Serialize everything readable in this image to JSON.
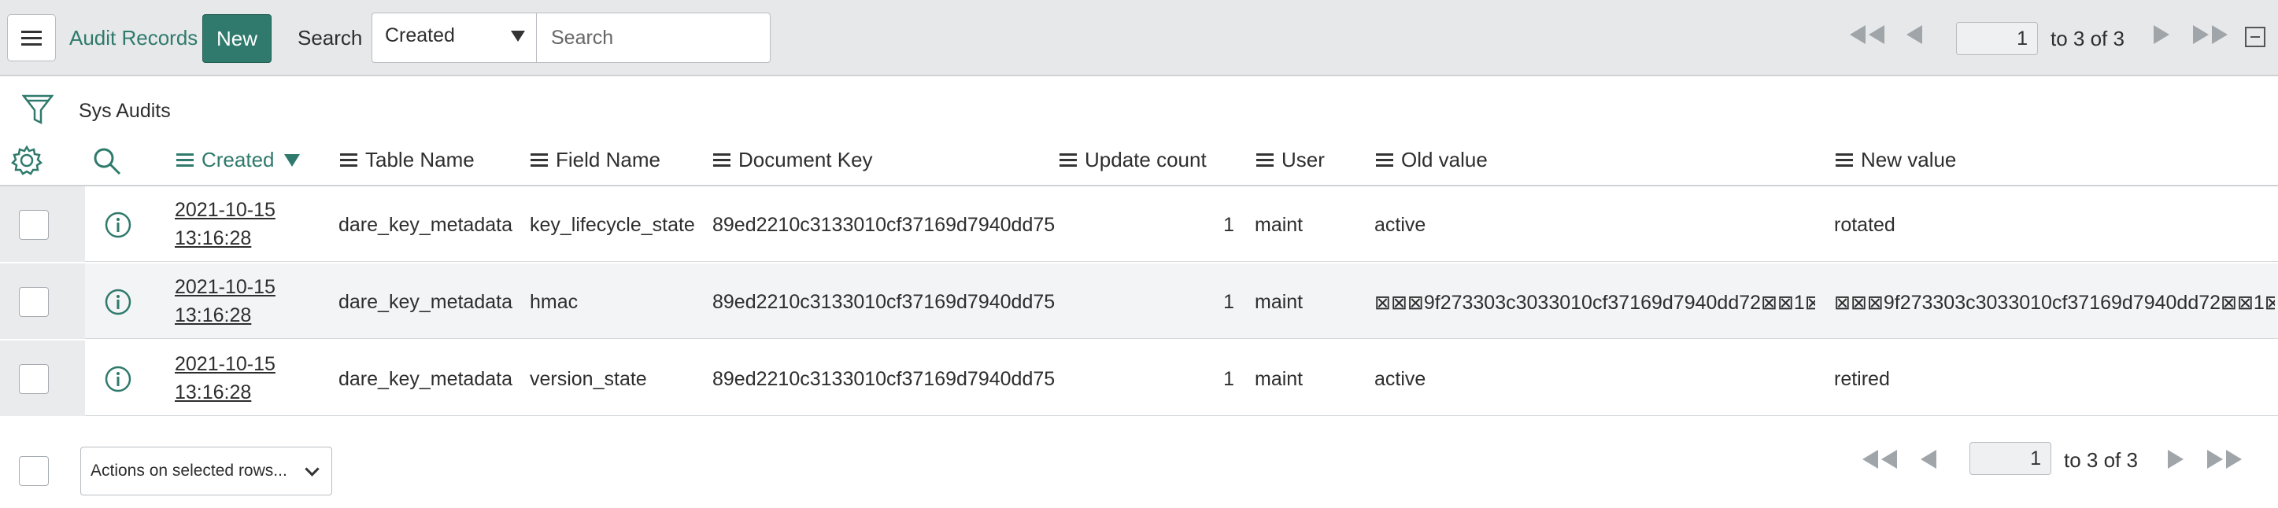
{
  "toolbar": {
    "title": "Audit Records",
    "new_label": "New",
    "search_label": "Search",
    "search_field": "Created",
    "search_placeholder": "Search",
    "page_current": "1",
    "page_total_text": "to 3 of 3"
  },
  "list": {
    "name": "Sys Audits",
    "columns": [
      {
        "label": "Created",
        "sorted": "descending"
      },
      {
        "label": "Table Name"
      },
      {
        "label": "Field Name"
      },
      {
        "label": "Document Key"
      },
      {
        "label": "Update count"
      },
      {
        "label": "User"
      },
      {
        "label": "Old value"
      },
      {
        "label": "New value"
      }
    ],
    "rows": [
      {
        "created_date": "2021-10-15",
        "created_time": "13:16:28",
        "table_name": "dare_key_metadata",
        "field_name": "key_lifecycle_state",
        "document_key": "89ed2210c3133010cf37169d7940dd75",
        "update_count": "1",
        "user": "maint",
        "old_value": "active",
        "new_value": "rotated"
      },
      {
        "created_date": "2021-10-15",
        "created_time": "13:16:28",
        "table_name": "dare_key_metadata",
        "field_name": "hmac",
        "document_key": "89ed2210c3133010cf37169d7940dd75",
        "update_count": "1",
        "user": "maint",
        "old_value": "⊠⊠⊠9f273303c3033010cf37169d7940dd72⊠⊠1⊠⊠...",
        "new_value": "⊠⊠⊠9f273303c3033010cf37169d7940dd72⊠⊠1⊠⊠..."
      },
      {
        "created_date": "2021-10-15",
        "created_time": "13:16:28",
        "table_name": "dare_key_metadata",
        "field_name": "version_state",
        "document_key": "89ed2210c3133010cf37169d7940dd75",
        "update_count": "1",
        "user": "maint",
        "old_value": "active",
        "new_value": "retired"
      }
    ]
  },
  "footer": {
    "actions_label": "Actions on selected rows...",
    "page_current": "1",
    "page_total_text": "to 3 of 3"
  },
  "colors": {
    "accent": "#2f7a6c",
    "toolbar_bg": "#e6e8ea"
  }
}
